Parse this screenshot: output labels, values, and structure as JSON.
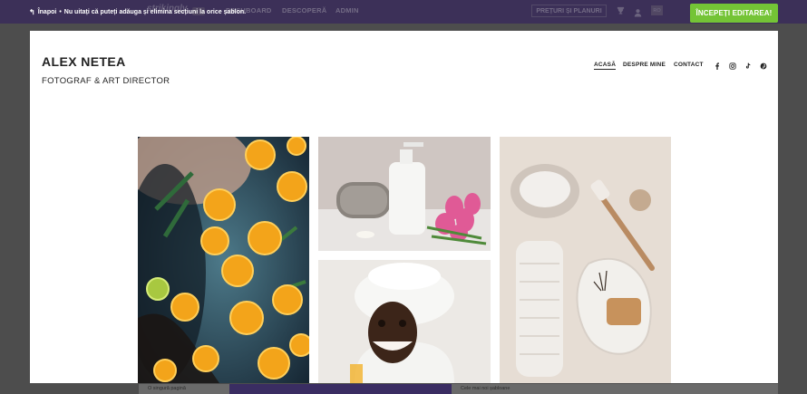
{
  "topbar": {
    "back_label": "Înapoi",
    "separator": "•",
    "note": "Nu uitați că puteți adăuga și elimina secțiuni la orice șablon.",
    "logo": "strikingly",
    "nav": [
      "DASHBOARD",
      "DESCOPERĂ",
      "ADMIN"
    ],
    "pricing_label": "PREȚURI ȘI PLANURI",
    "lang": "RO",
    "start_button": "ÎNCEPEȚI EDITAREA!",
    "accent_color": "#74c436",
    "bar_color": "#3a3154"
  },
  "background": {
    "left_text": "O singură pagină",
    "right_text": "Cele mai noi șabloane"
  },
  "site": {
    "title": "ALEX NETEA",
    "subtitle": "FOTOGRAF & ART DIRECTOR",
    "nav": [
      {
        "label": "ACASĂ",
        "active": true
      },
      {
        "label": "DESPRE MINE",
        "active": false
      },
      {
        "label": "CONTACT",
        "active": false
      }
    ],
    "social_icons": [
      "facebook-icon",
      "instagram-icon",
      "tiktok-icon",
      "pinterest-icon"
    ]
  },
  "gallery": [
    {
      "name": "photo-orange-bath"
    },
    {
      "name": "photo-towel-bottle-flowers"
    },
    {
      "name": "photo-face-mask"
    },
    {
      "name": "photo-spa-flatlay"
    }
  ]
}
